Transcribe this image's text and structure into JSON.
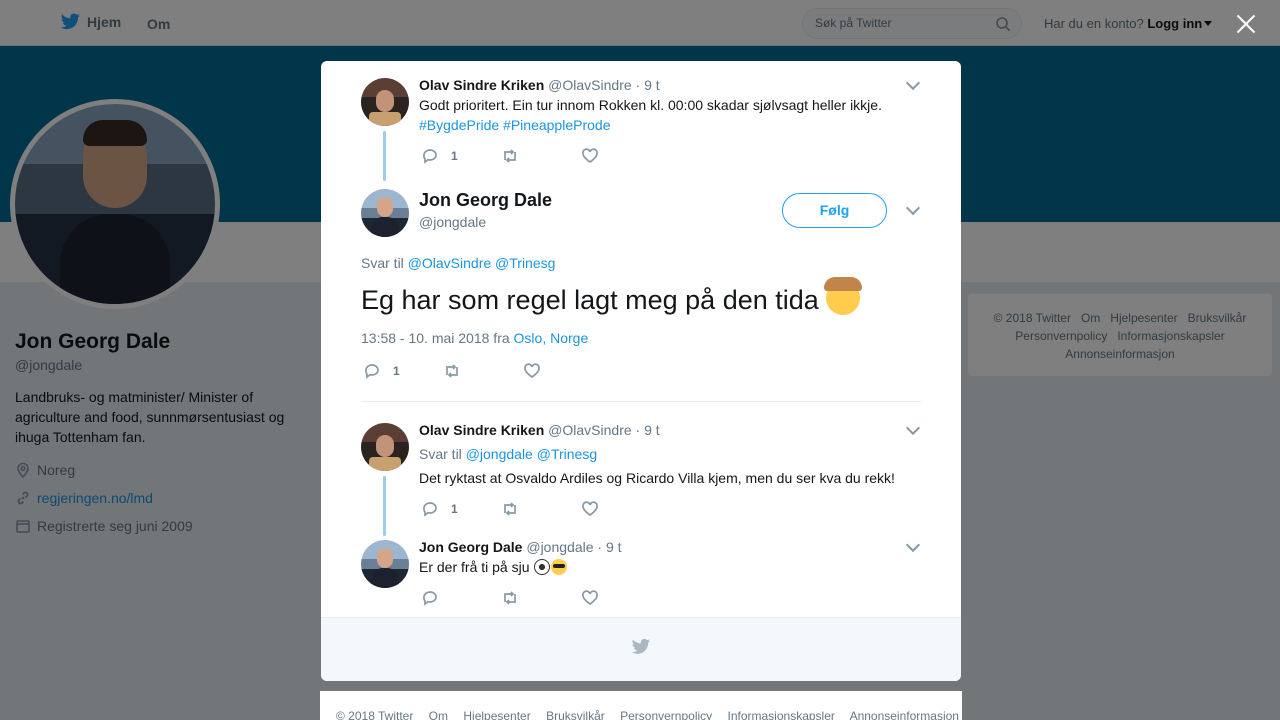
{
  "nav": {
    "home_label": "Hjem",
    "about_label": "Om",
    "search_placeholder": "Søk på Twitter",
    "account_question": "Har du en konto?",
    "login_label": "Logg inn"
  },
  "profile": {
    "name": "Jon Georg Dale",
    "handle": "@jongdale",
    "bio": "Landbruks- og matminister/ Minister of agriculture and food, sunnmørsentusiast og ihuga Tottenham fan.",
    "location": "Noreg",
    "website": "regjeringen.no/lmd",
    "joined": "Registrerte seg juni 2009"
  },
  "side_footer": [
    "© 2018 Twitter",
    "Om",
    "Hjelpesenter",
    "Bruksvilkår",
    "Personvernpolicy",
    "Informasjonskapsler",
    "Annonseinformasjon"
  ],
  "tweets": {
    "parent": {
      "name": "Olav Sindre Kriken",
      "handle": "@OlavSindre",
      "time": "· 9 t",
      "text": "Godt prioritert. Ein tur innom Rokken kl. 00:00 skadar sjølvsagt heller ikkje.",
      "hashtags": "#BygdePride #PineappleProde",
      "reply_count": "1"
    },
    "main": {
      "name": "Jon Georg Dale",
      "handle": "@jongdale",
      "follow_label": "Følg",
      "reply_prefix": "Svar til",
      "reply_mentions": "@OlavSindre @Trinesg",
      "text": "Eg har som regel lagt meg på den tida",
      "timestamp_prefix": "13:58 - 10. mai 2018 fra",
      "place": "Oslo, Norge",
      "reply_count": "1"
    },
    "reply1": {
      "name": "Olav Sindre Kriken",
      "handle": "@OlavSindre",
      "time": "· 9 t",
      "reply_prefix": "Svar til",
      "reply_mentions": "@jongdale @Trinesg",
      "text": "Det ryktast at Osvaldo Ardiles og Ricardo Villa kjem, men du ser kva du rekk!",
      "reply_count": "1"
    },
    "reply2": {
      "name": "Jon Georg Dale",
      "handle": "@jongdale",
      "time": "· 9 t",
      "text": "Er der frå ti på sju"
    }
  },
  "bottom_footer": [
    "© 2018 Twitter",
    "Om",
    "Hjelpesenter",
    "Bruksvilkår",
    "Personvernpolicy",
    "Informasjonskapsler",
    "Annonseinformasjon"
  ]
}
